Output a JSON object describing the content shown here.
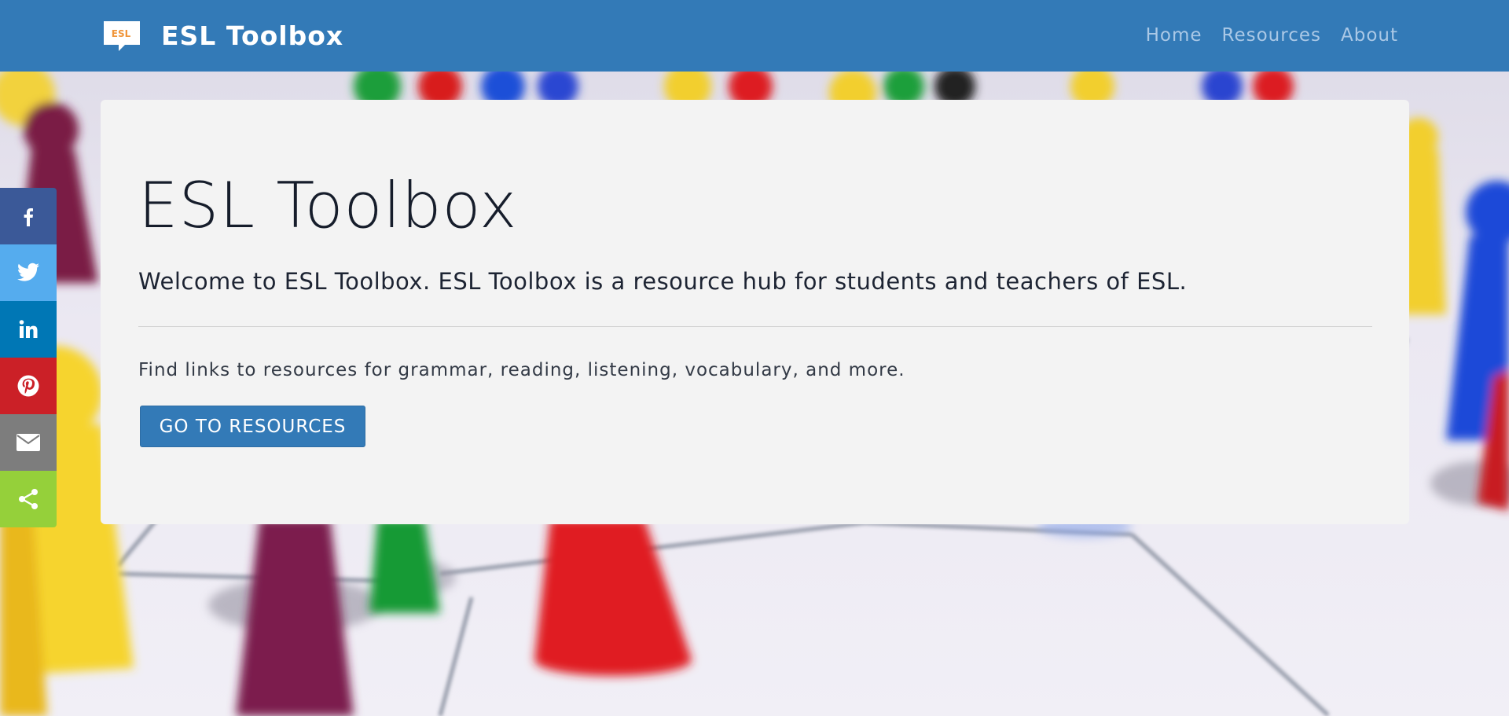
{
  "navbar": {
    "logo_text": "ESL",
    "brand_name": "ESL Toolbox",
    "links": [
      "Home",
      "Resources",
      "About"
    ]
  },
  "hero": {
    "title": "ESL Toolbox",
    "lead": "Welcome to ESL Toolbox. ESL Toolbox is a resource hub for students and teachers of ESL.",
    "text": "Find links to resources for grammar, reading, listening, vocabulary, and more.",
    "button_label": "GO TO RESOURCES"
  },
  "share": [
    {
      "icon": "facebook-icon",
      "color": "#3b5998"
    },
    {
      "icon": "twitter-icon",
      "color": "#55acee"
    },
    {
      "icon": "linkedin-icon",
      "color": "#0077b5"
    },
    {
      "icon": "pinterest-icon",
      "color": "#cb2027"
    },
    {
      "icon": "email-icon",
      "color": "#7d7d7d"
    },
    {
      "icon": "share-icon",
      "color": "#95d03a"
    }
  ],
  "colors": {
    "navbar": "#337ab7",
    "nav_link": "#aac8e6",
    "card": "#f3f3f3",
    "button": "#337ab7"
  }
}
